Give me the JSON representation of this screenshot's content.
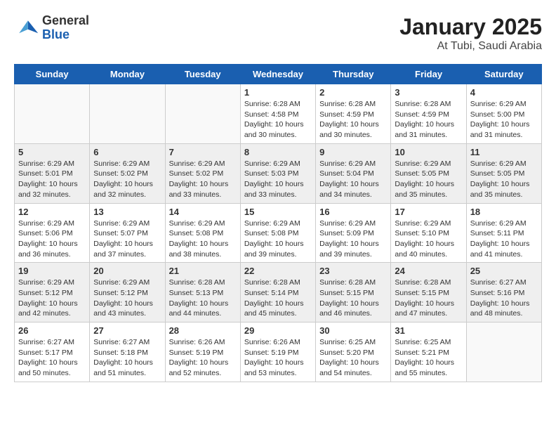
{
  "header": {
    "logo_general": "General",
    "logo_blue": "Blue",
    "title": "January 2025",
    "subtitle": "At Tubi, Saudi Arabia"
  },
  "weekdays": [
    "Sunday",
    "Monday",
    "Tuesday",
    "Wednesday",
    "Thursday",
    "Friday",
    "Saturday"
  ],
  "weeks": [
    [
      {
        "day": "",
        "info": ""
      },
      {
        "day": "",
        "info": ""
      },
      {
        "day": "",
        "info": ""
      },
      {
        "day": "1",
        "info": "Sunrise: 6:28 AM\nSunset: 4:58 PM\nDaylight: 10 hours\nand 30 minutes."
      },
      {
        "day": "2",
        "info": "Sunrise: 6:28 AM\nSunset: 4:59 PM\nDaylight: 10 hours\nand 30 minutes."
      },
      {
        "day": "3",
        "info": "Sunrise: 6:28 AM\nSunset: 4:59 PM\nDaylight: 10 hours\nand 31 minutes."
      },
      {
        "day": "4",
        "info": "Sunrise: 6:29 AM\nSunset: 5:00 PM\nDaylight: 10 hours\nand 31 minutes."
      }
    ],
    [
      {
        "day": "5",
        "info": "Sunrise: 6:29 AM\nSunset: 5:01 PM\nDaylight: 10 hours\nand 32 minutes."
      },
      {
        "day": "6",
        "info": "Sunrise: 6:29 AM\nSunset: 5:02 PM\nDaylight: 10 hours\nand 32 minutes."
      },
      {
        "day": "7",
        "info": "Sunrise: 6:29 AM\nSunset: 5:02 PM\nDaylight: 10 hours\nand 33 minutes."
      },
      {
        "day": "8",
        "info": "Sunrise: 6:29 AM\nSunset: 5:03 PM\nDaylight: 10 hours\nand 33 minutes."
      },
      {
        "day": "9",
        "info": "Sunrise: 6:29 AM\nSunset: 5:04 PM\nDaylight: 10 hours\nand 34 minutes."
      },
      {
        "day": "10",
        "info": "Sunrise: 6:29 AM\nSunset: 5:05 PM\nDaylight: 10 hours\nand 35 minutes."
      },
      {
        "day": "11",
        "info": "Sunrise: 6:29 AM\nSunset: 5:05 PM\nDaylight: 10 hours\nand 35 minutes."
      }
    ],
    [
      {
        "day": "12",
        "info": "Sunrise: 6:29 AM\nSunset: 5:06 PM\nDaylight: 10 hours\nand 36 minutes."
      },
      {
        "day": "13",
        "info": "Sunrise: 6:29 AM\nSunset: 5:07 PM\nDaylight: 10 hours\nand 37 minutes."
      },
      {
        "day": "14",
        "info": "Sunrise: 6:29 AM\nSunset: 5:08 PM\nDaylight: 10 hours\nand 38 minutes."
      },
      {
        "day": "15",
        "info": "Sunrise: 6:29 AM\nSunset: 5:08 PM\nDaylight: 10 hours\nand 39 minutes."
      },
      {
        "day": "16",
        "info": "Sunrise: 6:29 AM\nSunset: 5:09 PM\nDaylight: 10 hours\nand 39 minutes."
      },
      {
        "day": "17",
        "info": "Sunrise: 6:29 AM\nSunset: 5:10 PM\nDaylight: 10 hours\nand 40 minutes."
      },
      {
        "day": "18",
        "info": "Sunrise: 6:29 AM\nSunset: 5:11 PM\nDaylight: 10 hours\nand 41 minutes."
      }
    ],
    [
      {
        "day": "19",
        "info": "Sunrise: 6:29 AM\nSunset: 5:12 PM\nDaylight: 10 hours\nand 42 minutes."
      },
      {
        "day": "20",
        "info": "Sunrise: 6:29 AM\nSunset: 5:12 PM\nDaylight: 10 hours\nand 43 minutes."
      },
      {
        "day": "21",
        "info": "Sunrise: 6:28 AM\nSunset: 5:13 PM\nDaylight: 10 hours\nand 44 minutes."
      },
      {
        "day": "22",
        "info": "Sunrise: 6:28 AM\nSunset: 5:14 PM\nDaylight: 10 hours\nand 45 minutes."
      },
      {
        "day": "23",
        "info": "Sunrise: 6:28 AM\nSunset: 5:15 PM\nDaylight: 10 hours\nand 46 minutes."
      },
      {
        "day": "24",
        "info": "Sunrise: 6:28 AM\nSunset: 5:15 PM\nDaylight: 10 hours\nand 47 minutes."
      },
      {
        "day": "25",
        "info": "Sunrise: 6:27 AM\nSunset: 5:16 PM\nDaylight: 10 hours\nand 48 minutes."
      }
    ],
    [
      {
        "day": "26",
        "info": "Sunrise: 6:27 AM\nSunset: 5:17 PM\nDaylight: 10 hours\nand 50 minutes."
      },
      {
        "day": "27",
        "info": "Sunrise: 6:27 AM\nSunset: 5:18 PM\nDaylight: 10 hours\nand 51 minutes."
      },
      {
        "day": "28",
        "info": "Sunrise: 6:26 AM\nSunset: 5:19 PM\nDaylight: 10 hours\nand 52 minutes."
      },
      {
        "day": "29",
        "info": "Sunrise: 6:26 AM\nSunset: 5:19 PM\nDaylight: 10 hours\nand 53 minutes."
      },
      {
        "day": "30",
        "info": "Sunrise: 6:25 AM\nSunset: 5:20 PM\nDaylight: 10 hours\nand 54 minutes."
      },
      {
        "day": "31",
        "info": "Sunrise: 6:25 AM\nSunset: 5:21 PM\nDaylight: 10 hours\nand 55 minutes."
      },
      {
        "day": "",
        "info": ""
      }
    ]
  ]
}
